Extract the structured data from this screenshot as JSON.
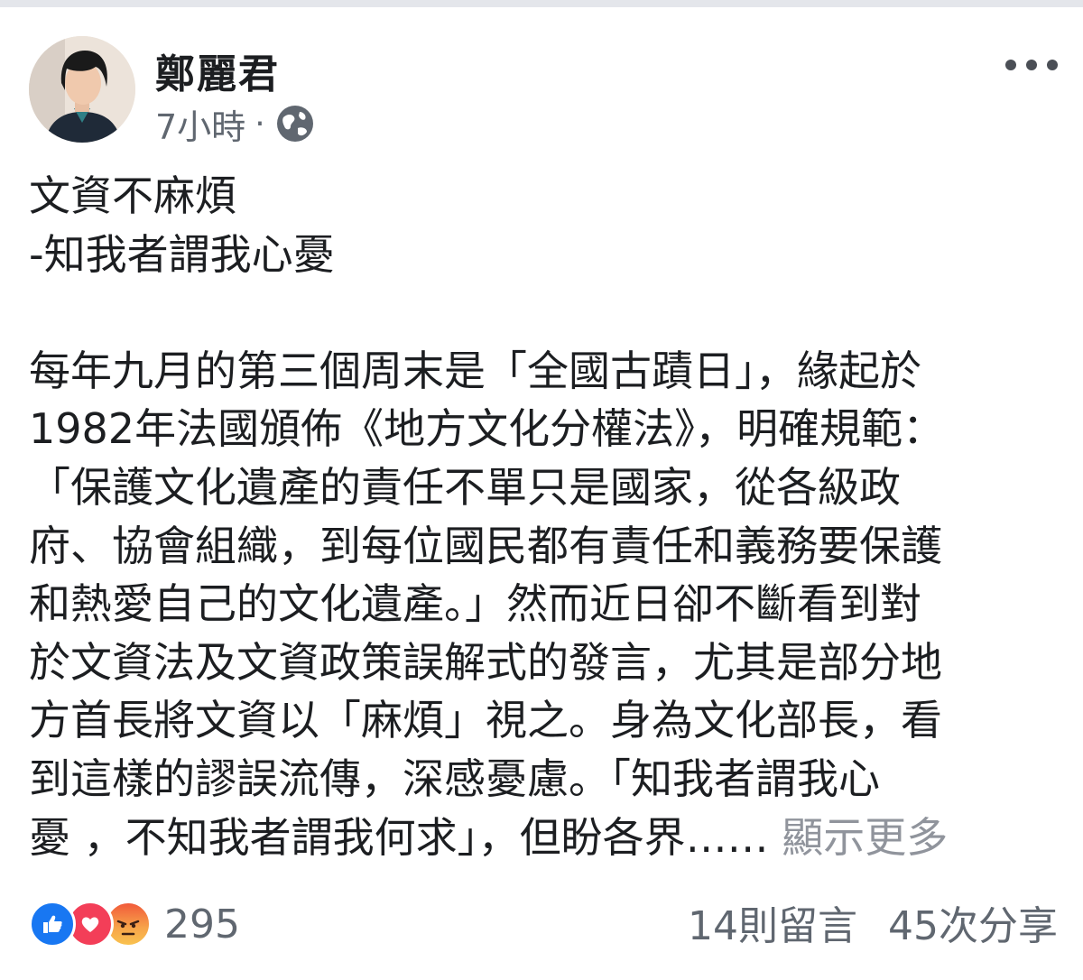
{
  "post": {
    "author": "鄭麗君",
    "time": "7小時",
    "separator": "·",
    "privacy_icon": "globe-icon",
    "more_icon": "more-options-icon",
    "body_lines": [
      "文資不麻煩",
      "-知我者謂我心憂",
      "",
      "每年九月的第三個周末是「全國古蹟日」，緣起於",
      "1982年法國頒佈《地方文化分權法》，明確規範：",
      "「保護文化遺產的責任不單只是國家，從各級政",
      "府、協會組織，到每位國民都有責任和義務要保護",
      "和熱愛自己的文化遺產。」然而近日卻不斷看到對",
      "於文資法及文資政策誤解式的發言，尤其是部分地",
      "方首長將文資以「麻煩」視之。身為文化部長，看",
      "到這樣的謬誤流傳，深感憂慮。「知我者謂我心",
      "憂 ，不知我者謂我何求」，但盼各界……"
    ],
    "see_more": "顯示更多"
  },
  "footer": {
    "reaction_icons": [
      "like-icon",
      "love-icon",
      "angry-icon"
    ],
    "reaction_count": "295",
    "comments": "14則留言",
    "shares": "45次分享"
  },
  "colors": {
    "like": "#1877f2",
    "love": "#f33e58",
    "angry": "#f7a54a",
    "secondary_text": "#606770",
    "see_more": "#90949c"
  }
}
